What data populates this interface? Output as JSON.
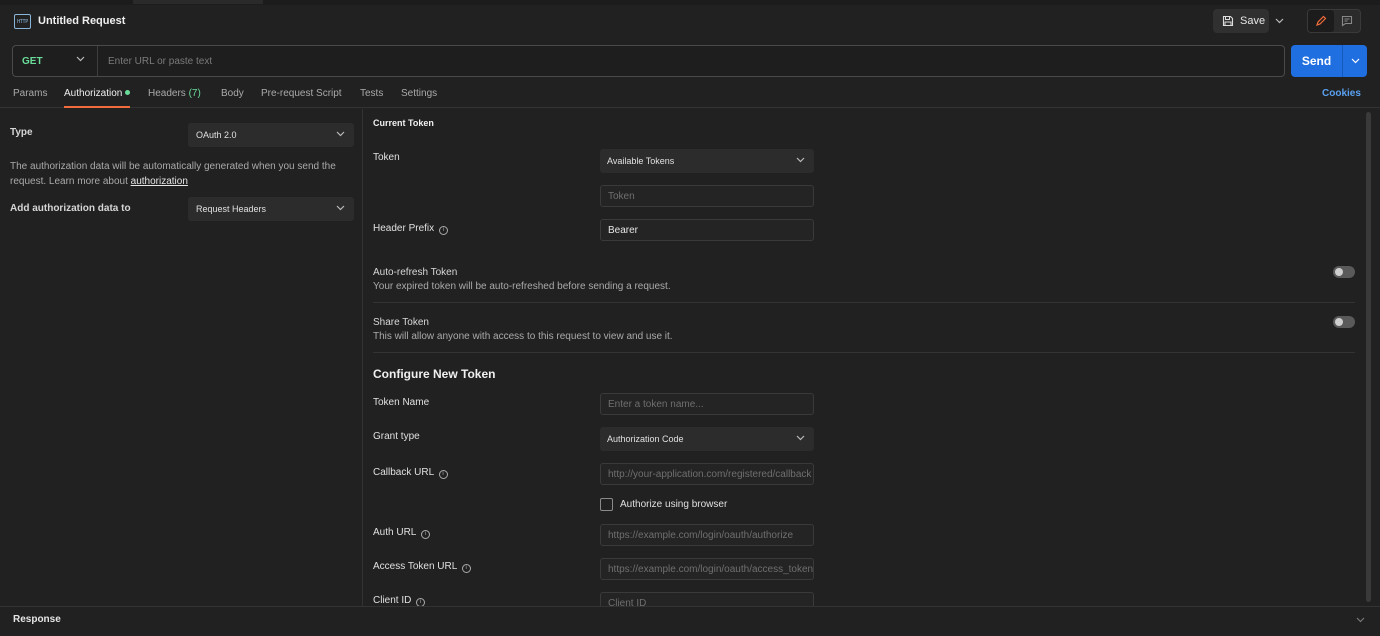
{
  "header": {
    "icon_text": "HTTP",
    "title": "Untitled Request",
    "save_label": "Save"
  },
  "request": {
    "method": "GET",
    "url_placeholder": "Enter URL or paste text",
    "send_label": "Send"
  },
  "tabs": {
    "params": "Params",
    "authorization": "Authorization",
    "headers": "Headers",
    "headers_count": "(7)",
    "body": "Body",
    "prerequest": "Pre-request Script",
    "tests": "Tests",
    "settings": "Settings",
    "cookies": "Cookies"
  },
  "auth": {
    "type_label": "Type",
    "type_value": "OAuth 2.0",
    "description": "The authorization data will be automatically generated when you send the request. Learn more about",
    "description_link": "authorization",
    "add_to_label": "Add authorization data to",
    "add_to_value": "Request Headers"
  },
  "current_token": {
    "section_title": "Current Token",
    "token_label": "Token",
    "available_tokens": "Available Tokens",
    "token_placeholder": "Token",
    "header_prefix_label": "Header Prefix",
    "header_prefix_value": "Bearer",
    "auto_refresh_title": "Auto-refresh Token",
    "auto_refresh_desc": "Your expired token will be auto-refreshed before sending a request.",
    "share_title": "Share Token",
    "share_desc": "This will allow anyone with access to this request to view and use it."
  },
  "new_token": {
    "section_title": "Configure New Token",
    "token_name_label": "Token Name",
    "token_name_placeholder": "Enter a token name...",
    "grant_type_label": "Grant type",
    "grant_type_value": "Authorization Code",
    "callback_url_label": "Callback URL",
    "callback_url_placeholder": "http://your-application.com/registered/callback",
    "authorize_browser_label": "Authorize using browser",
    "auth_url_label": "Auth URL",
    "auth_url_placeholder": "https://example.com/login/oauth/authorize",
    "access_token_url_label": "Access Token URL",
    "access_token_url_placeholder": "https://example.com/login/oauth/access_token",
    "client_id_label": "Client ID",
    "client_id_placeholder": "Client ID"
  },
  "response": {
    "title": "Response"
  },
  "colors": {
    "accent_blue": "#1f6fe0",
    "method_green": "#6bdd9a",
    "active_tab_orange": "#f26b3a",
    "link_blue": "#59a1f0"
  }
}
